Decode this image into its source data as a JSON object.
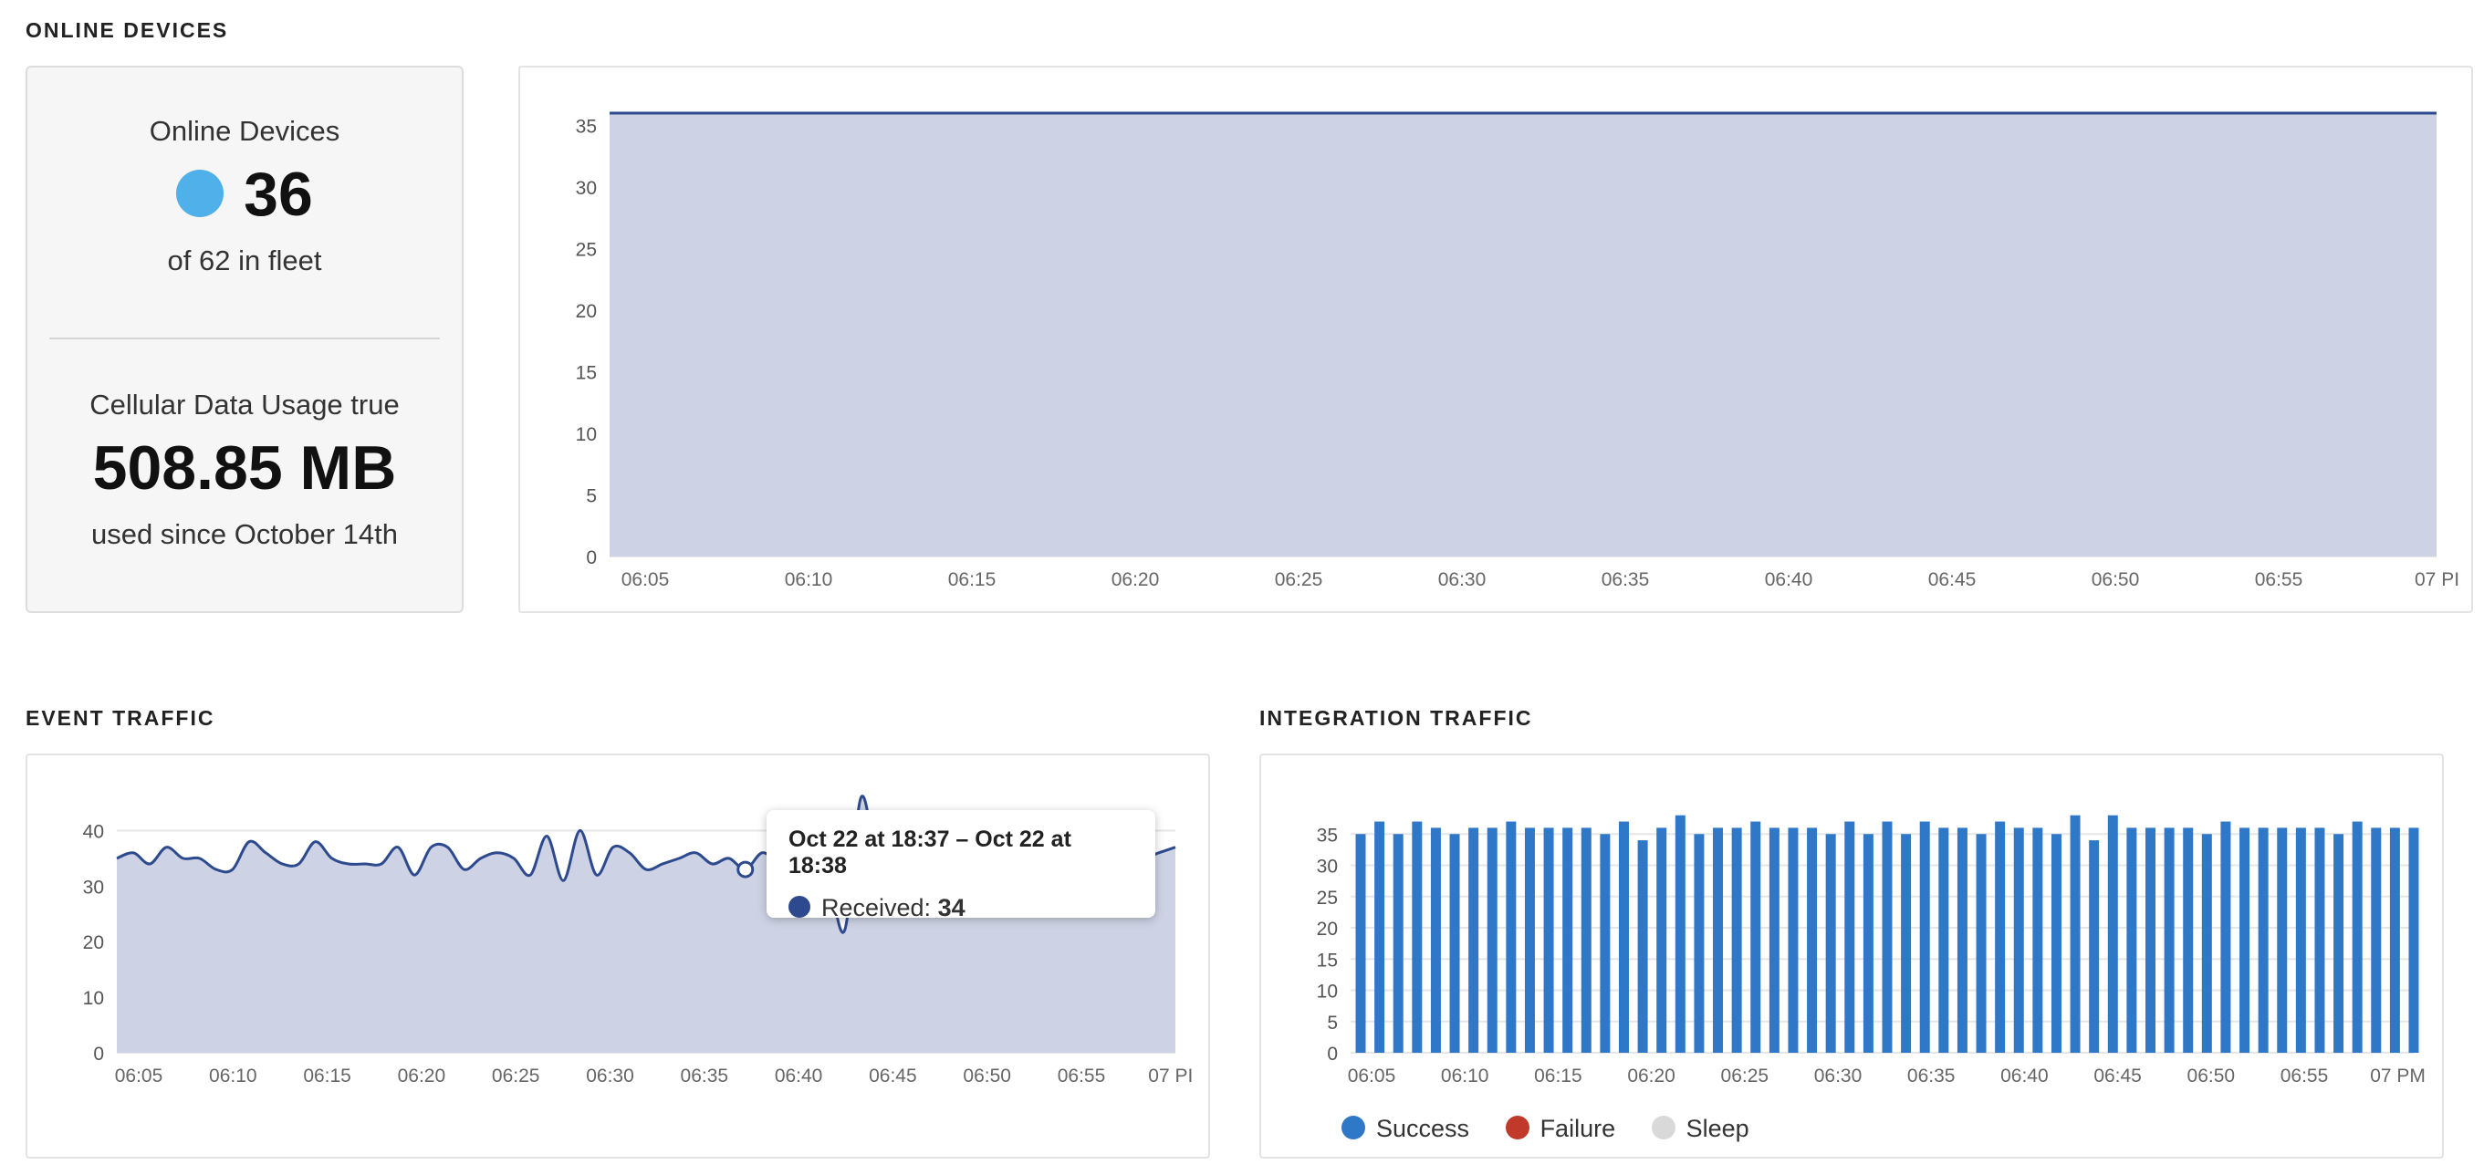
{
  "sections": {
    "online_devices": "ONLINE DEVICES",
    "event_traffic": "EVENT TRAFFIC",
    "integration_traffic": "INTEGRATION TRAFFIC"
  },
  "summary": {
    "online_label": "Online Devices",
    "online_count": "36",
    "fleet_text": "of 62 in fleet",
    "cellular_label": "Cellular Data Usage true",
    "cellular_value": "508.85 MB",
    "cellular_since": "used since October 14th",
    "status_color": "#4fb0ea"
  },
  "tooltip": {
    "title": "Oct 22 at 18:37 – Oct 22 at 18:38",
    "series": "Received:",
    "value": "34"
  },
  "legend": [
    {
      "label": "Success",
      "color": "#2f78c8"
    },
    {
      "label": "Failure",
      "color": "#c0392b"
    },
    {
      "label": "Sleep",
      "color": "#d9d9d9"
    }
  ],
  "chart_data": [
    {
      "type": "area",
      "x_ticks": [
        "06:05",
        "06:10",
        "06:15",
        "06:20",
        "06:25",
        "06:30",
        "06:35",
        "06:40",
        "06:45",
        "06:50",
        "06:55",
        "07 PI"
      ],
      "ylim": [
        0,
        36
      ],
      "y_ticks": [
        0,
        5,
        10,
        15,
        20,
        25,
        30,
        35
      ],
      "series": [
        {
          "values": [
            36,
            36
          ]
        }
      ]
    },
    {
      "type": "area",
      "x_ticks": [
        "06:05",
        "06:10",
        "06:15",
        "06:20",
        "06:25",
        "06:30",
        "06:35",
        "06:40",
        "06:45",
        "06:50",
        "06:55",
        "07 PI"
      ],
      "ylim": [
        0,
        45
      ],
      "y_ticks": [
        0,
        10,
        20,
        30,
        40
      ],
      "series": [
        {
          "name": "Received",
          "values": [
            35,
            36,
            34,
            37,
            35,
            35,
            33,
            33,
            38,
            36,
            34,
            34,
            38,
            35,
            34,
            34,
            34,
            37,
            32,
            37,
            37,
            33,
            35,
            36,
            35,
            32,
            39,
            31,
            40,
            32,
            37,
            36,
            33,
            34,
            35,
            36,
            34,
            35,
            33,
            36,
            35,
            40,
            36,
            32,
            22,
            46,
            34,
            35,
            36,
            35,
            34,
            37,
            36,
            35,
            35,
            36,
            34,
            35,
            36,
            37,
            33,
            36,
            35,
            36,
            37
          ]
        }
      ]
    },
    {
      "type": "bar",
      "x_ticks": [
        "06:05",
        "06:10",
        "06:15",
        "06:20",
        "06:25",
        "06:30",
        "06:35",
        "06:40",
        "06:45",
        "06:50",
        "06:55",
        "07 PM"
      ],
      "ylim": [
        0,
        40
      ],
      "y_ticks": [
        0,
        5,
        10,
        15,
        20,
        25,
        30,
        35
      ],
      "series": [
        {
          "name": "Success",
          "values": [
            35,
            37,
            35,
            37,
            36,
            35,
            36,
            36,
            37,
            36,
            36,
            36,
            36,
            35,
            37,
            34,
            36,
            38,
            35,
            36,
            36,
            37,
            36,
            36,
            36,
            35,
            37,
            35,
            37,
            35,
            37,
            36,
            36,
            35,
            37,
            36,
            36,
            35,
            38,
            34,
            38,
            36,
            36,
            36,
            36,
            35,
            37,
            36,
            36,
            36,
            36,
            36,
            35,
            37,
            36,
            36,
            36
          ]
        }
      ]
    }
  ]
}
